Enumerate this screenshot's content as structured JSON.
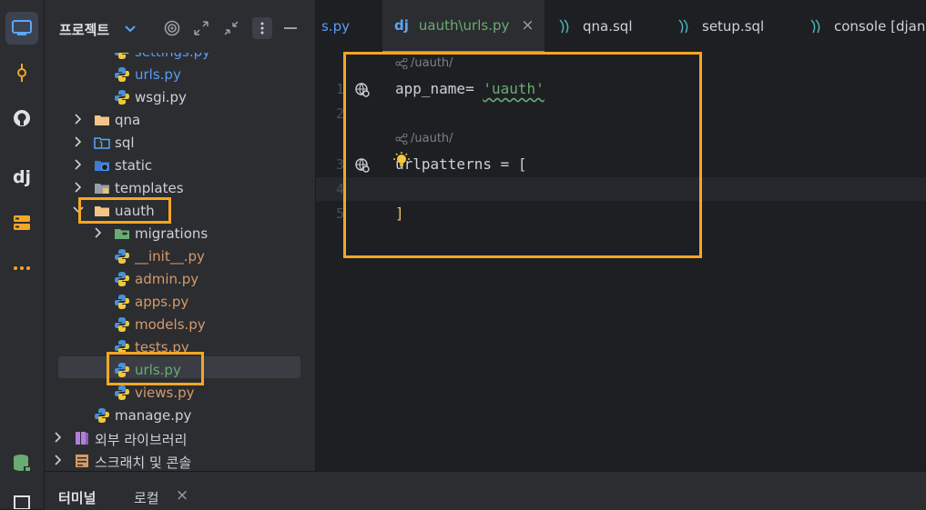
{
  "project_panel": {
    "title": "프로젝트",
    "items": [
      {
        "label": "settings.py",
        "type": "py",
        "indent": 3,
        "color": "#5a9cf5"
      },
      {
        "label": "urls.py",
        "type": "py",
        "indent": 3,
        "color": "#5a9cf5"
      },
      {
        "label": "wsgi.py",
        "type": "py",
        "indent": 3,
        "color": "#cdd1d8"
      },
      {
        "label": "qna",
        "type": "folder",
        "indent": 2,
        "chev": "right",
        "color": "#cdd1d8"
      },
      {
        "label": "sql",
        "type": "sqlfolder",
        "indent": 2,
        "chev": "right",
        "color": "#cdd1d8"
      },
      {
        "label": "static",
        "type": "webfolder",
        "indent": 2,
        "chev": "right",
        "color": "#cdd1d8"
      },
      {
        "label": "templates",
        "type": "tplfolder",
        "indent": 2,
        "chev": "right",
        "color": "#cdd1d8"
      },
      {
        "label": "uauth",
        "type": "folder",
        "indent": 2,
        "chev": "down",
        "color": "#cdd1d8"
      },
      {
        "label": "migrations",
        "type": "migfolder",
        "indent": 3,
        "chev": "right",
        "color": "#cdd1d8"
      },
      {
        "label": "__init__.py",
        "type": "py",
        "indent": 3,
        "color": "#d49a6a"
      },
      {
        "label": "admin.py",
        "type": "py",
        "indent": 3,
        "color": "#d49a6a"
      },
      {
        "label": "apps.py",
        "type": "py",
        "indent": 3,
        "color": "#d49a6a"
      },
      {
        "label": "models.py",
        "type": "py",
        "indent": 3,
        "color": "#d49a6a"
      },
      {
        "label": "tests.py",
        "type": "py",
        "indent": 3,
        "color": "#d49a6a"
      },
      {
        "label": "urls.py",
        "type": "py",
        "indent": 3,
        "color": "#6aab73",
        "selected": true
      },
      {
        "label": "views.py",
        "type": "py",
        "indent": 3,
        "color": "#d49a6a"
      },
      {
        "label": "manage.py",
        "type": "py",
        "indent": 2,
        "color": "#cdd1d8"
      },
      {
        "label": "외부 라이브러리",
        "type": "lib",
        "indent": 1,
        "chev": "right",
        "color": "#cdd1d8"
      },
      {
        "label": "스크래치 및 콘솔",
        "type": "scratch",
        "indent": 1,
        "chev": "right",
        "color": "#cdd1d8"
      }
    ]
  },
  "tabs": [
    {
      "label": "s.py",
      "icon": "python-icon",
      "active": false,
      "color": "#5a9cf5"
    },
    {
      "label": "uauth\\urls.py",
      "icon": "django-icon",
      "active": true,
      "color": "#6aab73",
      "closable": true
    },
    {
      "label": "qna.sql",
      "icon": "sql-icon",
      "active": false,
      "color": "#cdd1d8"
    },
    {
      "label": "setup.sql",
      "icon": "sql-icon",
      "active": false,
      "color": "#cdd1d8"
    },
    {
      "label": "console [djang",
      "icon": "sql-icon",
      "active": false,
      "color": "#cdd1d8"
    }
  ],
  "editor": {
    "hints": [
      {
        "text": "/uauth/"
      },
      {
        "text": "/uauth/"
      }
    ],
    "lines": [
      {
        "num": "1",
        "code_a": "app_name= ",
        "code_str": "'uauth'"
      },
      {
        "num": "2",
        "code_a": ""
      },
      {
        "num": "3",
        "code_a": "urlpatterns = ["
      },
      {
        "num": "4",
        "code_a": ""
      },
      {
        "num": "5",
        "code_a": "]"
      }
    ]
  },
  "bottom": {
    "tab_terminal": "터미널",
    "tab_local": "로컬",
    "close_glyph": "×"
  },
  "tab_close_glyph": "×"
}
